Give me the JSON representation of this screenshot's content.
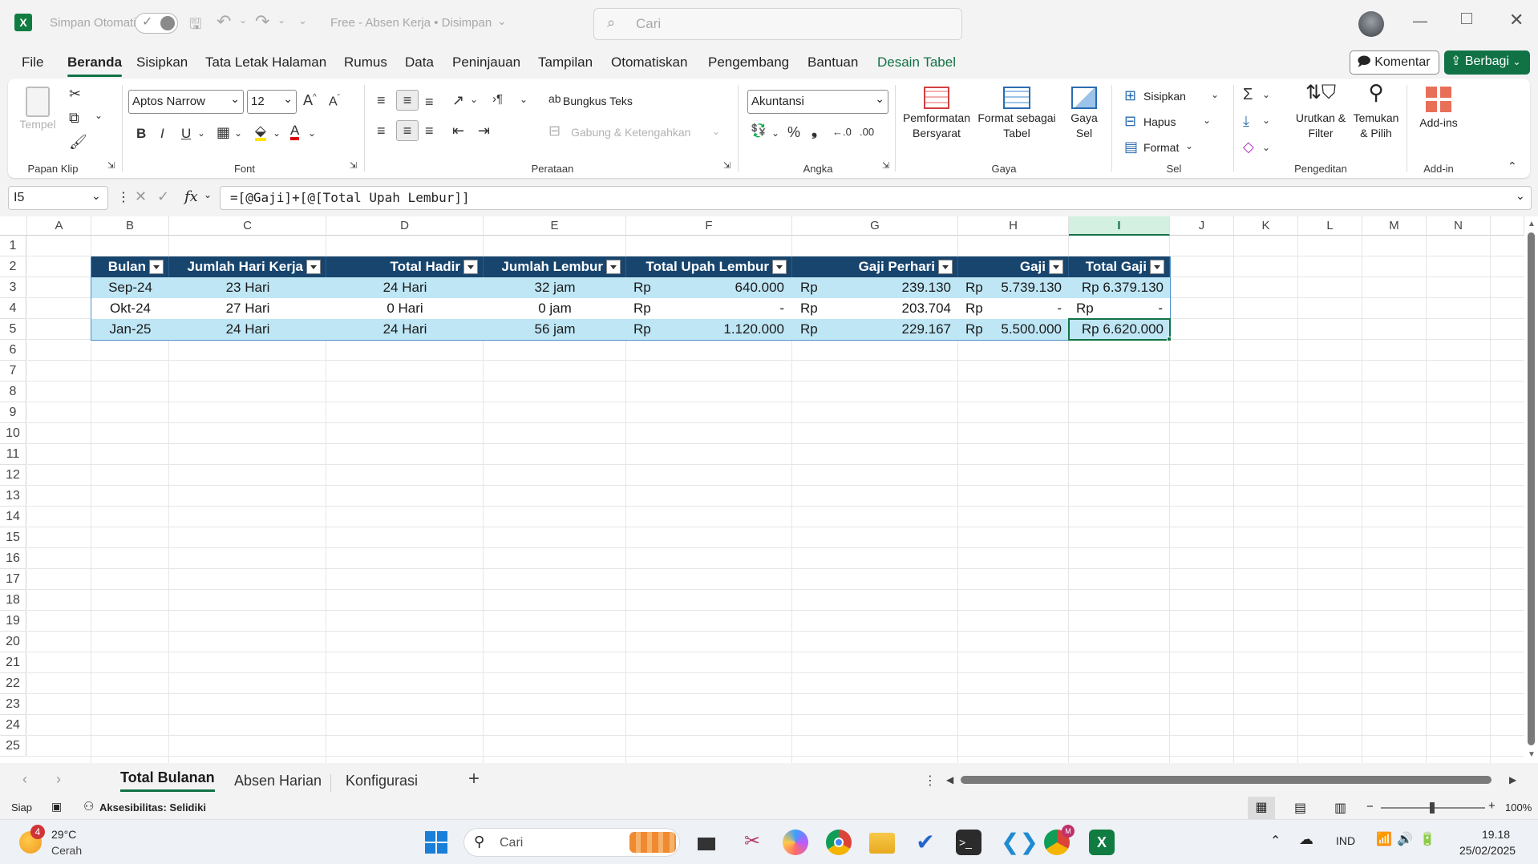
{
  "app": {
    "autosave_label": "Simpan Otomatis",
    "doc_title": "Free - Absen Kerja • Disimpan",
    "search_placeholder": "Cari"
  },
  "menu": {
    "items": [
      "File",
      "Beranda",
      "Sisipkan",
      "Tata Letak Halaman",
      "Rumus",
      "Data",
      "Peninjauan",
      "Tampilan",
      "Otomatiskan",
      "Pengembang",
      "Bantuan",
      "Desain Tabel"
    ],
    "comment_label": "Komentar",
    "share_label": "Berbagi"
  },
  "ribbon": {
    "clipboard": {
      "paste": "Tempel",
      "label": "Papan Klip"
    },
    "font": {
      "name": "Aptos Narrow",
      "size": "12",
      "label": "Font"
    },
    "alignment": {
      "wrap": "Bungkus Teks",
      "merge": "Gabung & Ketengahkan",
      "label": "Perataan"
    },
    "number": {
      "format": "Akuntansi",
      "label": "Angka"
    },
    "styles": {
      "conditional_1": "Pemformatan",
      "conditional_2": "Bersyarat",
      "format_table_1": "Format sebagai",
      "format_table_2": "Tabel",
      "cell_style_1": "Gaya",
      "cell_style_2": "Sel",
      "label": "Gaya"
    },
    "cells": {
      "insert": "Sisipkan",
      "delete": "Hapus",
      "format": "Format",
      "label": "Sel"
    },
    "editing": {
      "sort_1": "Urutkan &",
      "sort_2": "Filter",
      "find_1": "Temukan",
      "find_2": "& Pilih",
      "label": "Pengeditan"
    },
    "addins": {
      "btn": "Add-ins",
      "label": "Add-in"
    }
  },
  "formula_bar": {
    "name_box": "I5",
    "fx": "fx",
    "formula": "=[@Gaji]+[@[Total Upah Lembur]]"
  },
  "grid": {
    "columns": [
      "A",
      "B",
      "C",
      "D",
      "E",
      "F",
      "G",
      "H",
      "I",
      "J",
      "K",
      "L",
      "M",
      "N"
    ],
    "rows": [
      "1",
      "2",
      "3",
      "4",
      "5",
      "6",
      "7",
      "8",
      "9",
      "10",
      "11",
      "12",
      "13",
      "14",
      "15",
      "16",
      "17",
      "18",
      "19",
      "20",
      "21",
      "22",
      "23",
      "24",
      "25"
    ]
  },
  "table": {
    "headers": [
      "Bulan",
      "Jumlah Hari Kerja",
      "Total Hadir",
      "Jumlah Lembur",
      "Total Upah Lembur",
      "Gaji Perhari",
      "Gaji",
      "Total Gaji"
    ],
    "rows": [
      {
        "bulan": "Sep-24",
        "hari_kerja": "23 Hari",
        "hadir": "24 Hari",
        "lembur": "32 jam",
        "rp1": "Rp",
        "upah": "640.000",
        "rp2": "Rp",
        "perhari": "239.130",
        "rp3": "Rp",
        "gaji": "5.739.130",
        "total": "Rp 6.379.130"
      },
      {
        "bulan": "Okt-24",
        "hari_kerja": "27 Hari",
        "hadir": "0 Hari",
        "lembur": "0 jam",
        "rp1": "Rp",
        "upah": "-",
        "rp2": "Rp",
        "perhari": "203.704",
        "rp3": "Rp",
        "gaji": "-",
        "total": "Rp",
        "total_dash": "-"
      },
      {
        "bulan": "Jan-25",
        "hari_kerja": "24 Hari",
        "hadir": "24 Hari",
        "lembur": "56 jam",
        "rp1": "Rp",
        "upah": "1.120.000",
        "rp2": "Rp",
        "perhari": "229.167",
        "rp3": "Rp",
        "gaji": "5.500.000",
        "total": "Rp 6.620.000"
      }
    ]
  },
  "sheets": {
    "tabs": [
      "Total Bulanan",
      "Absen Harian",
      "Konfigurasi"
    ],
    "active": "Total Bulanan"
  },
  "status": {
    "ready": "Siap",
    "accessibility": "Aksesibilitas: Selidiki",
    "zoom": "100%"
  },
  "taskbar": {
    "temp": "29°C",
    "weather": "Cerah",
    "weather_badge": "4",
    "search": "Cari",
    "lang": "IND",
    "time": "19.18",
    "date": "25/02/2025"
  },
  "colors": {
    "header_bg": "#17456e",
    "row_band": "#bfe6f5",
    "accent": "#117245"
  }
}
